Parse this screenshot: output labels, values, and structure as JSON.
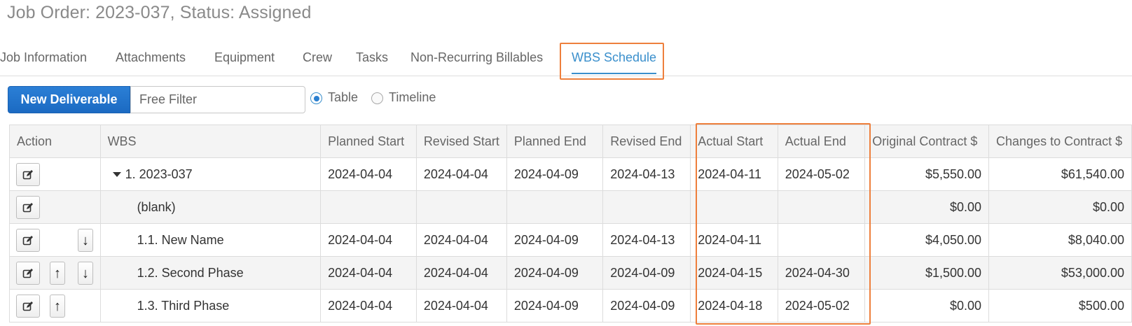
{
  "page": {
    "title": "Job Order: 2023-037, Status: Assigned"
  },
  "tabs": [
    {
      "label": "Job Information"
    },
    {
      "label": "Attachments"
    },
    {
      "label": "Equipment"
    },
    {
      "label": "Crew"
    },
    {
      "label": "Tasks"
    },
    {
      "label": "Non-Recurring Billables"
    },
    {
      "label": "WBS Schedule",
      "active": true
    }
  ],
  "toolbar": {
    "new_button": "New Deliverable",
    "filter_placeholder": "Free Filter",
    "view_options": [
      {
        "label": "Table",
        "selected": true
      },
      {
        "label": "Timeline",
        "selected": false
      }
    ]
  },
  "table": {
    "columns": [
      "Action",
      "WBS",
      "Planned Start",
      "Revised Start",
      "Planned End",
      "Revised End",
      "Actual Start",
      "Actual End",
      "Original Contract $",
      "Changes to Contract $"
    ],
    "rows": [
      {
        "wbs": "1. 2023-037",
        "planned_start": "2024-04-04",
        "revised_start": "2024-04-04",
        "planned_end": "2024-04-09",
        "revised_end": "2024-04-13",
        "actual_start": "2024-04-11",
        "actual_end": "2024-05-02",
        "original": "$5,550.00",
        "changes": "$61,540.00"
      },
      {
        "wbs": "(blank)",
        "planned_start": "",
        "revised_start": "",
        "planned_end": "",
        "revised_end": "",
        "actual_start": "",
        "actual_end": "",
        "original": "$0.00",
        "changes": "$0.00"
      },
      {
        "wbs": "1.1. New Name",
        "planned_start": "2024-04-04",
        "revised_start": "2024-04-04",
        "planned_end": "2024-04-09",
        "revised_end": "2024-04-13",
        "actual_start": "2024-04-11",
        "actual_end": "",
        "original": "$4,050.00",
        "changes": "$8,040.00"
      },
      {
        "wbs": "1.2. Second Phase",
        "planned_start": "2024-04-04",
        "revised_start": "2024-04-04",
        "planned_end": "2024-04-09",
        "revised_end": "2024-04-09",
        "actual_start": "2024-04-15",
        "actual_end": "2024-04-30",
        "original": "$1,500.00",
        "changes": "$53,000.00"
      },
      {
        "wbs": "1.3. Third Phase",
        "planned_start": "2024-04-04",
        "revised_start": "2024-04-04",
        "planned_end": "2024-04-09",
        "revised_end": "2024-04-09",
        "actual_start": "2024-04-18",
        "actual_end": "2024-05-02",
        "original": "$0.00",
        "changes": "$500.00"
      }
    ]
  },
  "icons": {
    "edit": "edit-icon",
    "up": "arrow-up-icon",
    "down": "arrow-down-icon",
    "expand": "caret-down-icon"
  },
  "colors": {
    "accent": "#3a8fcc",
    "primary_button": "#1b6ac2",
    "highlight": "#ee7f3c"
  }
}
